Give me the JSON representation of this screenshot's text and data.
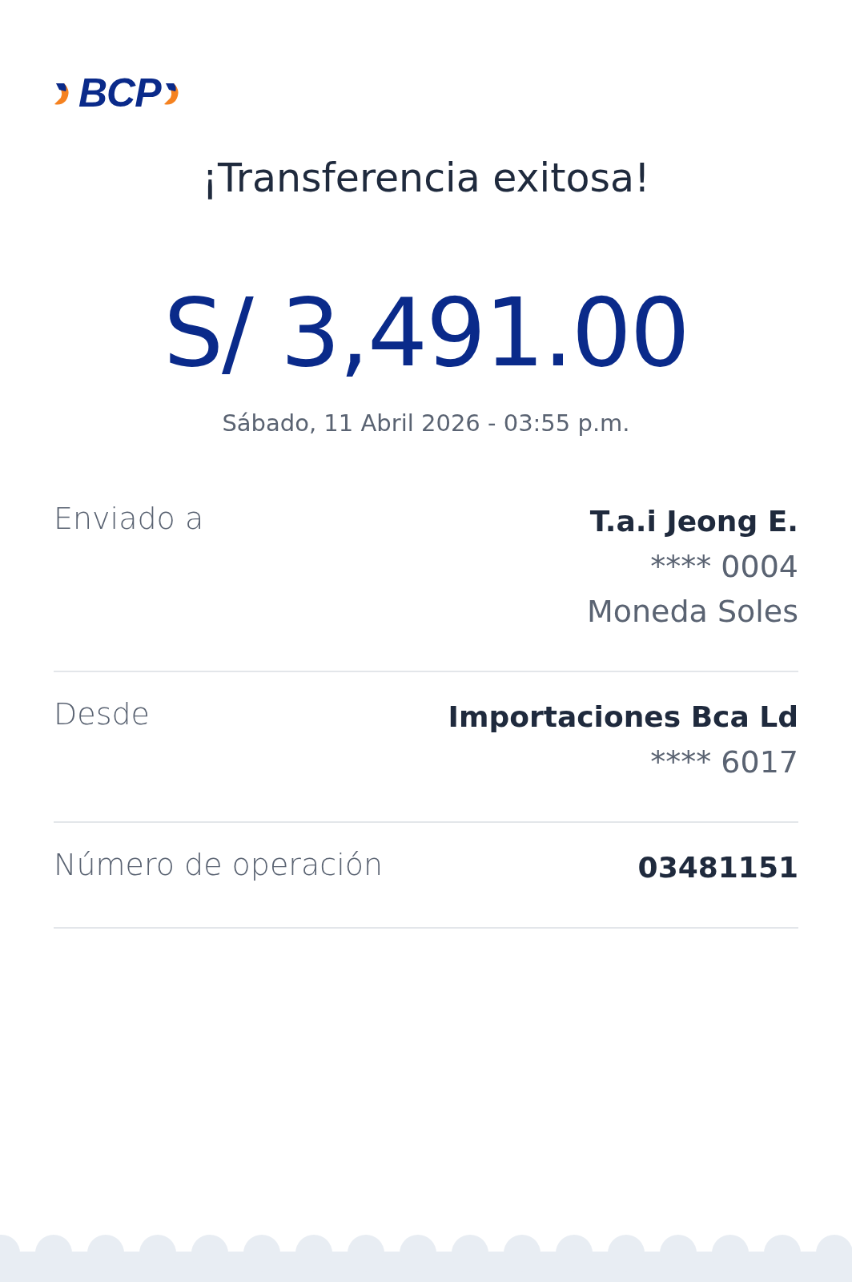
{
  "logo": {
    "text": "BCP"
  },
  "title": "¡Transferencia exitosa!",
  "amount": "S/ 3,491.00",
  "datetime": "Sábado, 11 Abril 2026 - 03:55 p.m.",
  "details": [
    {
      "label": "Enviado a",
      "lines": [
        {
          "text": "T.a.i Jeong E.",
          "kind": "strong"
        },
        {
          "text": "**** 0004",
          "kind": "plain"
        },
        {
          "text": "Moneda Soles",
          "kind": "plain"
        }
      ]
    },
    {
      "label": "Desde",
      "lines": [
        {
          "text": "Importaciones Bca Ld",
          "kind": "strong"
        },
        {
          "text": "**** 6017",
          "kind": "plain"
        }
      ]
    },
    {
      "label": "Número de operación",
      "lines": [
        {
          "text": "03481151",
          "kind": "strong"
        }
      ]
    }
  ]
}
